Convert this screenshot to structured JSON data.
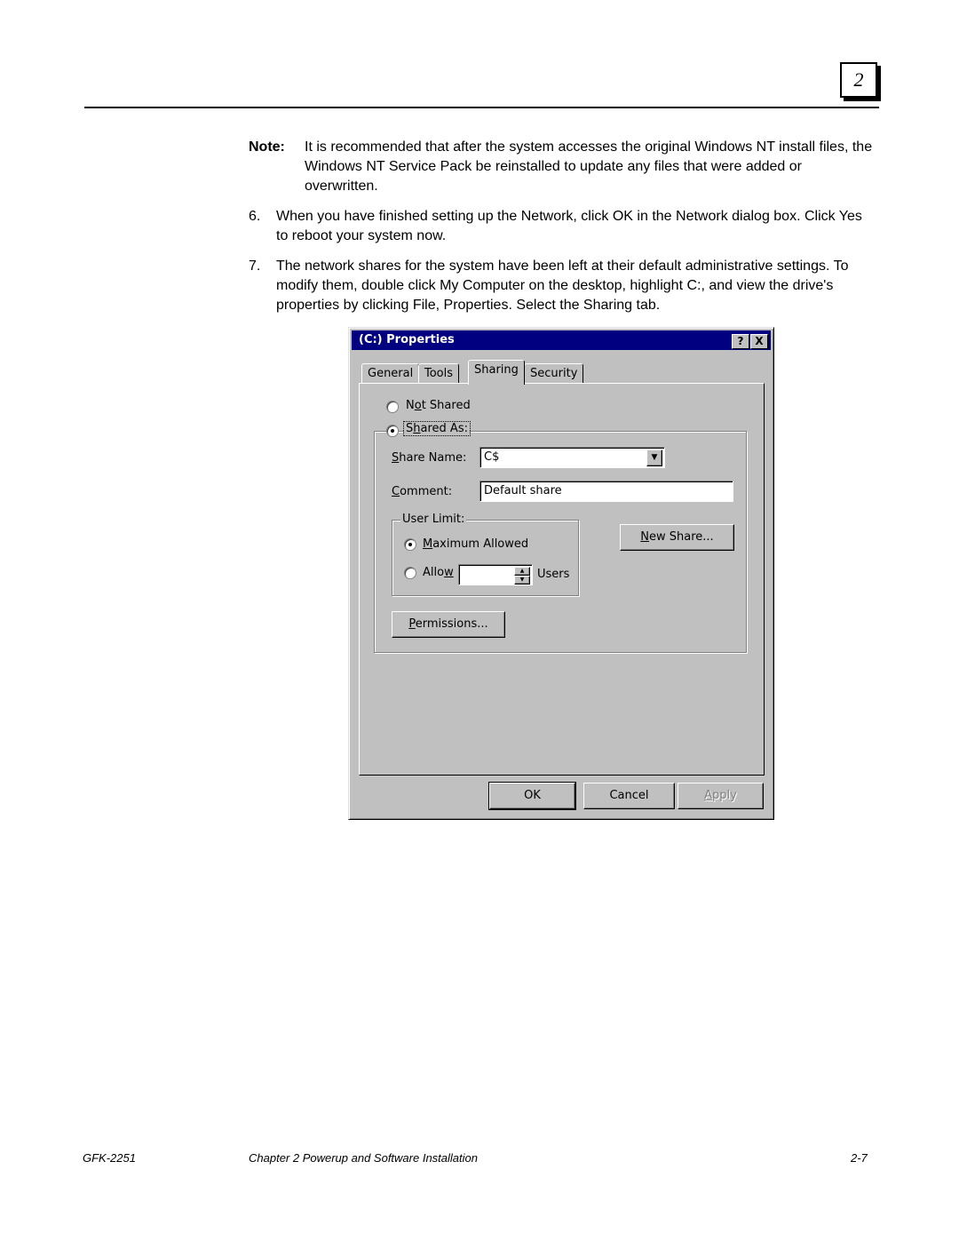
{
  "header": {
    "chapter_number": "2"
  },
  "note": {
    "label": "Note:",
    "text": "It is recommended that after the system accesses the original Windows NT install files, the Windows NT Service Pack be reinstalled to update any files that were added or overwritten."
  },
  "steps": [
    {
      "number": "6.",
      "text": "When you have finished setting up the Network, click OK in the Network dialog box. Click Yes to reboot your system now."
    },
    {
      "number": "7.",
      "text": "The network shares for the system have been left at their default administrative settings. To modify them, double click My Computer on the desktop, highlight C:, and view the drive's properties by clicking File, Properties. Select the Sharing tab."
    }
  ],
  "dialog": {
    "title": "(C:) Properties",
    "help_label": "?",
    "close_label": "X",
    "tabs": [
      {
        "label": "General"
      },
      {
        "label": "Tools"
      },
      {
        "label": "Sharing",
        "active": true
      },
      {
        "label": "Security"
      }
    ],
    "not_shared": {
      "pre": "N",
      "u": "o",
      "post": "t Shared"
    },
    "shared_as": {
      "pre": "S",
      "u": "h",
      "post": "ared As:"
    },
    "share_name": {
      "label_u": "S",
      "label_rest": "hare Name:",
      "value": "C$"
    },
    "comment": {
      "label_u": "C",
      "label_rest": "omment:",
      "value": "Default share"
    },
    "user_limit": {
      "legend": "User Limit:",
      "maximum": {
        "u": "M",
        "rest": "aximum Allowed"
      },
      "allow": {
        "pre": "Allo",
        "u": "w"
      },
      "allow_value": "",
      "users_label": "Users"
    },
    "new_share": {
      "u": "N",
      "rest": "ew Share..."
    },
    "permissions": {
      "u": "P",
      "rest": "ermissions..."
    },
    "ok_label": "OK",
    "cancel_label": "Cancel",
    "apply": {
      "u": "A",
      "rest": "pply"
    }
  },
  "footer": {
    "doc_id": "GFK-2251",
    "chapter": "Chapter 2  Powerup and Software Installation",
    "page": "2-7"
  }
}
